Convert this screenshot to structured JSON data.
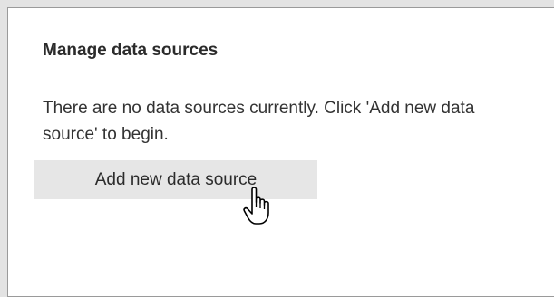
{
  "panel": {
    "title": "Manage data sources",
    "message": "There are no data sources currently. Click 'Add new data source' to begin.",
    "add_button_label": "Add new data source"
  },
  "cursor": {
    "icon": "hand-pointer-icon"
  },
  "colors": {
    "background": "#e3e3e3",
    "panel_background": "#ffffff",
    "panel_border": "#9a9a9a",
    "button_background": "#e6e6e6",
    "text": "#2b2b2b"
  }
}
